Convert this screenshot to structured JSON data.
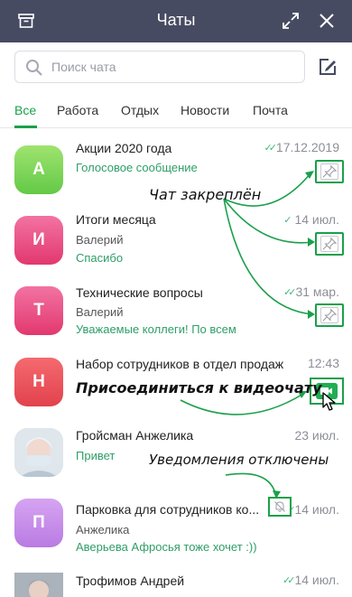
{
  "window": {
    "title": "Чаты",
    "icons": {
      "archive": "archive-icon",
      "expand": "expand-icon",
      "close": "close-icon"
    }
  },
  "search": {
    "placeholder": "Поиск чата",
    "value": "",
    "icon": "search-icon"
  },
  "compose_icon": "compose-icon",
  "tabs": [
    {
      "label": "Все",
      "active": true
    },
    {
      "label": "Работа",
      "active": false
    },
    {
      "label": "Отдых",
      "active": false
    },
    {
      "label": "Новости",
      "active": false
    },
    {
      "label": "Почта",
      "active": false
    }
  ],
  "chats": [
    {
      "avatar_letter": "А",
      "title": "Акции 2020 года",
      "line1": "Голосовое сообщение",
      "line2": "",
      "time": "17.12.2019",
      "read": true,
      "pinned": true
    },
    {
      "avatar_letter": "И",
      "title": "Итоги месяца",
      "line1": "Валерий",
      "line2": "Спасибо",
      "time": "14 июл.",
      "read": true,
      "pinned": true
    },
    {
      "avatar_letter": "Т",
      "title": "Технические вопросы",
      "line1": "Валерий",
      "line2": "Уважаемые коллеги! По всем",
      "time": "31 мар.",
      "read": true,
      "pinned": true
    },
    {
      "avatar_letter": "Н",
      "title": "Набор сотрудников в отдел продаж",
      "line1": "",
      "line2": "",
      "time": "12:43",
      "read": false,
      "video_call": true
    },
    {
      "avatar_letter": "",
      "title": "Гройсман Анжелика",
      "line1": "Привет",
      "line2": "",
      "time": "23 июл.",
      "read": false
    },
    {
      "avatar_letter": "П",
      "title": "Парковка для сотрудников ко...",
      "line1": "Анжелика",
      "line2": "Аверьева Афросья тоже хочет :))",
      "time": "14 июл.",
      "read": true,
      "muted": true
    },
    {
      "avatar_letter": "",
      "title": "Трофимов Андрей",
      "line1": "",
      "line2": "",
      "time": "14 июл.",
      "read": true
    }
  ],
  "annotations": {
    "pinned": "Чат закреплён",
    "video": "Присоединиться к видеочату",
    "muted": "Уведомления отключены"
  },
  "colors": {
    "header": "#474b62",
    "accent": "#1aa04a",
    "avatar_a": "#7dd35c",
    "avatar_i": "#ea4b82",
    "avatar_t": "#ea4b82",
    "avatar_n": "#ea4b57",
    "avatar_p": "#c78be8"
  }
}
